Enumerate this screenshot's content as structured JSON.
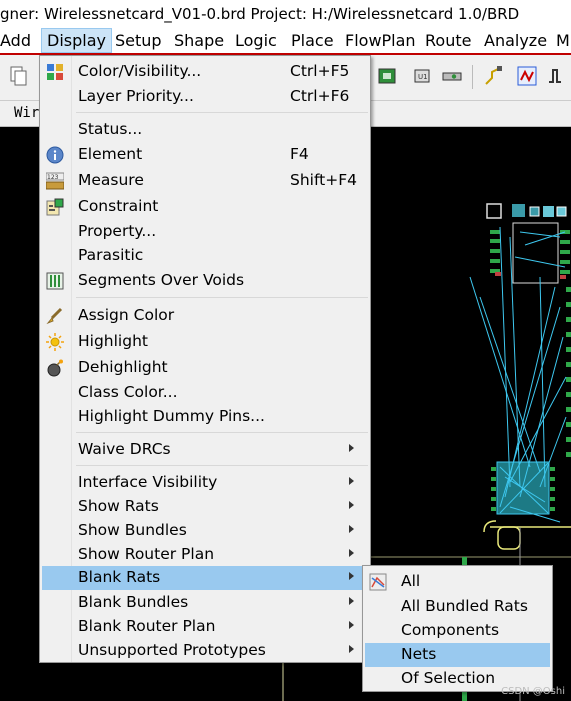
{
  "window": {
    "title": "gner: Wirelessnetcard_V01-0.brd  Project: H:/Wirelessnetcard 1.0/BRD"
  },
  "menubar": {
    "items": [
      "Add",
      "Display",
      "Setup",
      "Shape",
      "Logic",
      "Place",
      "FlowPlan",
      "Route",
      "Analyze",
      "M"
    ],
    "open": "Display"
  },
  "tabstrip": {
    "tab_label": "Wir"
  },
  "display_menu": {
    "items": [
      {
        "label": "Color/Visibility...",
        "shortcut": "Ctrl+F5",
        "icon": "color-palette-icon"
      },
      {
        "label": "Layer Priority...",
        "shortcut": "Ctrl+F6"
      },
      {
        "label": "Status..."
      },
      {
        "label": "Element",
        "shortcut": "F4",
        "icon": "info-icon"
      },
      {
        "label": "Measure",
        "shortcut": "Shift+F4",
        "icon": "measure-icon"
      },
      {
        "label": "Constraint",
        "icon": "constraint-icon"
      },
      {
        "label": "Property..."
      },
      {
        "label": "Parasitic"
      },
      {
        "label": "Segments Over Voids",
        "icon": "segments-icon"
      },
      {
        "label": "Assign Color",
        "icon": "brush-icon"
      },
      {
        "label": "Highlight",
        "icon": "sun-icon"
      },
      {
        "label": "Dehighlight",
        "icon": "bomb-icon"
      },
      {
        "label": "Class Color..."
      },
      {
        "label": "Highlight Dummy Pins..."
      },
      {
        "label": "Waive DRCs",
        "submenu": true
      },
      {
        "label": "Interface Visibility",
        "submenu": true
      },
      {
        "label": "Show Rats",
        "submenu": true
      },
      {
        "label": "Show Bundles",
        "submenu": true
      },
      {
        "label": "Show Router Plan",
        "submenu": true
      },
      {
        "label": "Blank Rats",
        "submenu": true,
        "highlighted": true
      },
      {
        "label": "Blank Bundles",
        "submenu": true
      },
      {
        "label": "Blank Router Plan",
        "submenu": true
      },
      {
        "label": "Unsupported Prototypes",
        "submenu": true
      }
    ]
  },
  "blank_rats_submenu": {
    "items": [
      {
        "label": "All",
        "icon": "blank-rats-icon"
      },
      {
        "label": "All Bundled Rats"
      },
      {
        "label": "Components"
      },
      {
        "label": "Nets",
        "highlighted": true
      },
      {
        "label": "Of Selection"
      }
    ]
  },
  "watermark": "CSDN @Oshi",
  "colors": {
    "highlight": "#99c9ef",
    "menubar_border": "#c00000",
    "rats": "#3ec8f0",
    "pads_green": "#2fa84a"
  }
}
